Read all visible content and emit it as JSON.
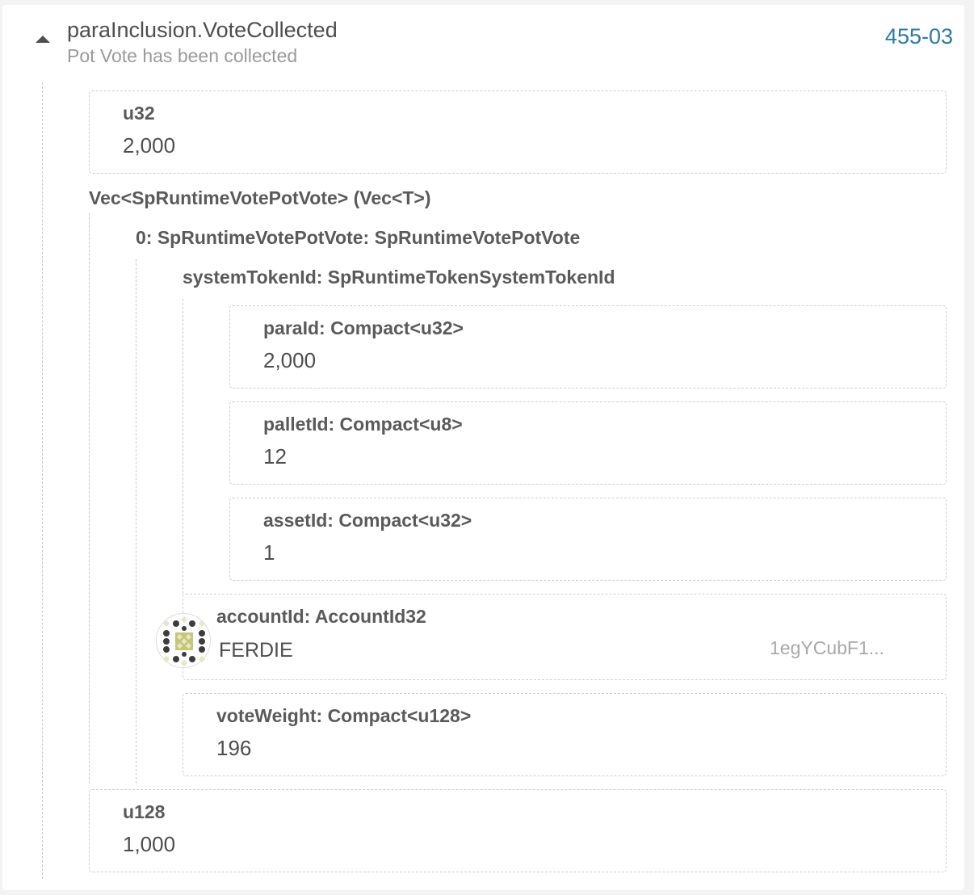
{
  "event": {
    "title": "paraInclusion.VoteCollected",
    "description": "Pot Vote has been collected",
    "block_link": "455-03"
  },
  "params": {
    "u32": {
      "type": "u32",
      "value": "2,000"
    },
    "vec": {
      "label": "Vec<SpRuntimeVotePotVote> (Vec<T>)",
      "item0": {
        "label": "0: SpRuntimeVotePotVote: SpRuntimeVotePotVote",
        "systemTokenId": {
          "label": "systemTokenId: SpRuntimeTokenSystemTokenId",
          "paraId": {
            "label": "paraId: Compact<u32>",
            "value": "2,000"
          },
          "palletId": {
            "label": "palletId: Compact<u8>",
            "value": "12"
          },
          "assetId": {
            "label": "assetId: Compact<u32>",
            "value": "1"
          }
        },
        "accountId": {
          "label": "accountId: AccountId32",
          "name": "FERDIE",
          "address": "1egYCubF1..."
        },
        "voteWeight": {
          "label": "voteWeight: Compact<u128>",
          "value": "196"
        }
      }
    },
    "u128": {
      "type": "u128",
      "value": "1,000"
    }
  },
  "icons": {
    "toggle": "caret-up-icon",
    "avatar": "identicon-icon"
  },
  "colors": {
    "link": "#2b7aa8",
    "text": "#4e4e4e",
    "muted": "#9a9a9a",
    "identicon_dark": "#3c3c3c",
    "identicon_accent": "#c6c67a",
    "identicon_light": "#e7e7c8"
  }
}
